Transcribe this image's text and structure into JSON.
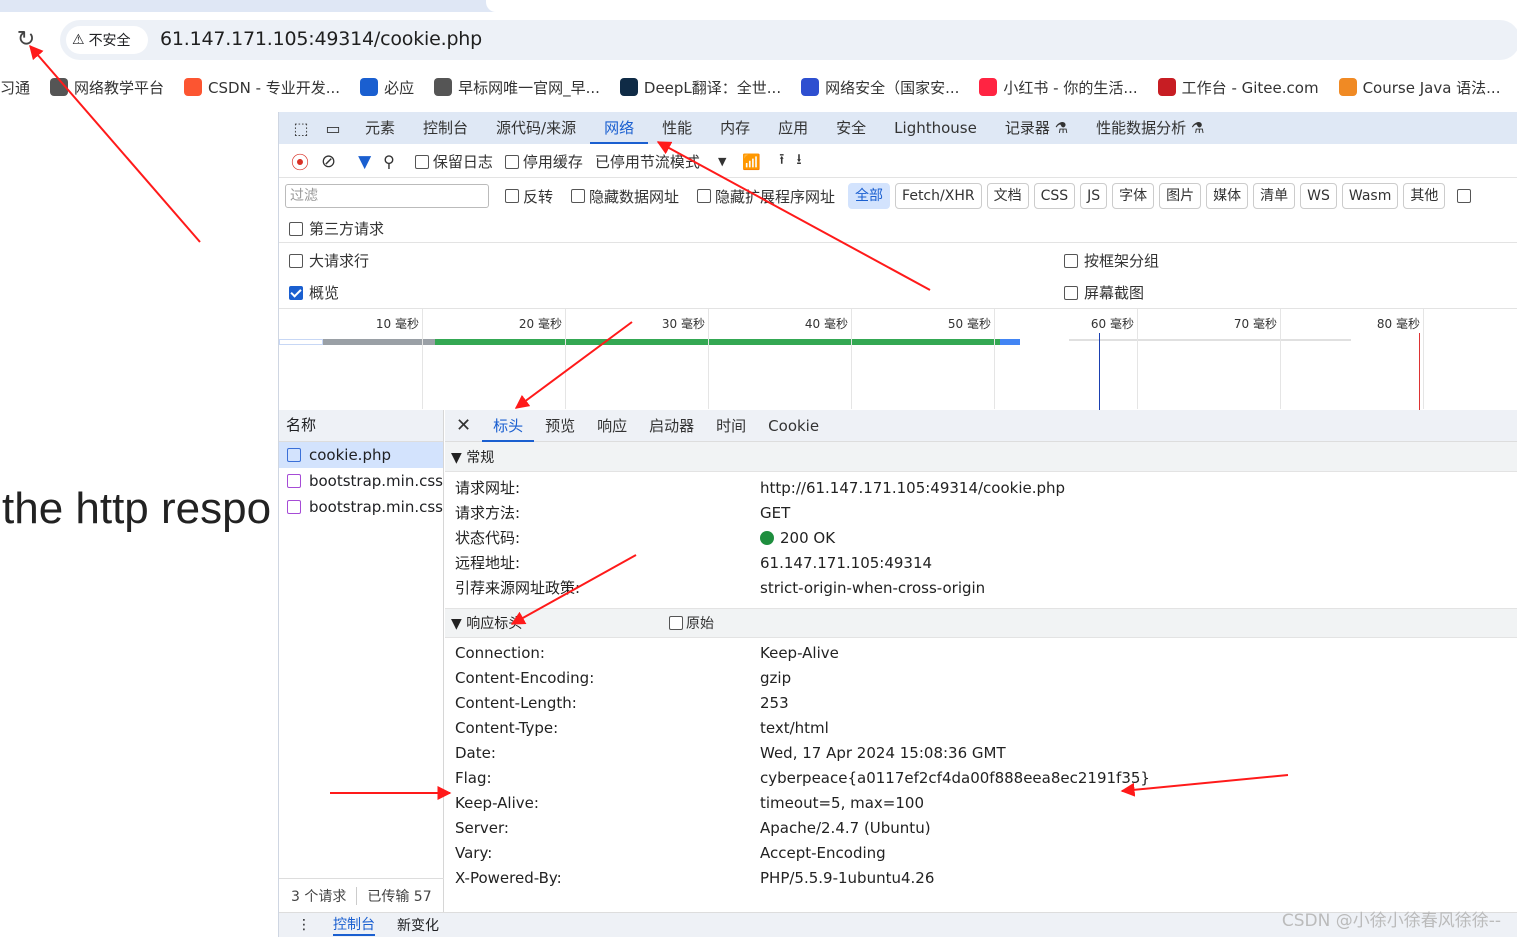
{
  "browser": {
    "security_label": "不安全",
    "url": "61.147.171.105:49314/cookie.php",
    "bookmarks": [
      {
        "label": "习通",
        "icon": "none",
        "color": "#ffffff"
      },
      {
        "label": "网络教学平台",
        "icon": "globe-icon",
        "color": "#555555"
      },
      {
        "label": "CSDN - 专业开发...",
        "icon": "csdn-icon",
        "color": "#fc5531"
      },
      {
        "label": "必应",
        "icon": "search-icon",
        "color": "#1a5fd0"
      },
      {
        "label": "早标网唯一官网_早...",
        "icon": "globe-icon",
        "color": "#555555"
      },
      {
        "label": "DeepL翻译：全世...",
        "icon": "deepl-icon",
        "color": "#0f2b46"
      },
      {
        "label": "网络安全（国家安...",
        "icon": "paw-icon",
        "color": "#2e4fd0"
      },
      {
        "label": "小红书 - 你的生活...",
        "icon": "xiaohongshu-icon",
        "color": "#ff2442"
      },
      {
        "label": "工作台 - Gitee.com",
        "icon": "gitee-icon",
        "color": "#c71d23"
      },
      {
        "label": "Course Java 语法...",
        "icon": "course-icon",
        "color": "#f08a24"
      }
    ]
  },
  "page": {
    "visible_text": "the http respo"
  },
  "devtools": {
    "tabs": [
      "元素",
      "控制台",
      "源代码/来源",
      "网络",
      "性能",
      "内存",
      "应用",
      "安全",
      "Lighthouse",
      "记录器 ⚗",
      "性能数据分析 ⚗"
    ],
    "active_tab": "网络",
    "toolbar": {
      "preserve_log": "保留日志",
      "disable_cache": "停用缓存",
      "throttle": "已停用节流模式"
    },
    "filter": {
      "placeholder": "过滤",
      "invert": "反转",
      "hide_data_urls": "隐藏数据网址",
      "hide_ext_urls": "隐藏扩展程序网址",
      "types": [
        "全部",
        "Fetch/XHR",
        "文档",
        "CSS",
        "JS",
        "字体",
        "图片",
        "媒体",
        "清单",
        "WS",
        "Wasm",
        "其他"
      ],
      "active_type": "全部"
    },
    "options": {
      "third_party": "第三方请求",
      "big_rows": "大请求行",
      "overview": "概览",
      "group_by_frame": "按框架分组",
      "screenshots": "屏幕截图"
    },
    "timeline_ticks": [
      "10 毫秒",
      "20 毫秒",
      "30 毫秒",
      "40 毫秒",
      "50 毫秒",
      "60 毫秒",
      "70 毫秒",
      "80 毫秒"
    ],
    "name_header": "名称",
    "requests": [
      {
        "name": "cookie.php",
        "type": "doc"
      },
      {
        "name": "bootstrap.min.css",
        "type": "css"
      },
      {
        "name": "bootstrap.min.css",
        "type": "css"
      }
    ],
    "status": {
      "count": "3 个请求",
      "transferred": "已传输 57"
    },
    "detail_tabs": [
      "标头",
      "预览",
      "响应",
      "启动器",
      "时间",
      "Cookie"
    ],
    "active_detail_tab": "标头",
    "general": {
      "title": "▼ 常规",
      "rows": [
        {
          "k": "请求网址:",
          "v": "http://61.147.171.105:49314/cookie.php"
        },
        {
          "k": "请求方法:",
          "v": "GET"
        },
        {
          "k": "状态代码:",
          "v": "200 OK"
        },
        {
          "k": "远程地址:",
          "v": "61.147.171.105:49314"
        },
        {
          "k": "引荐来源网址政策:",
          "v": "strict-origin-when-cross-origin"
        }
      ]
    },
    "response_headers": {
      "title": "▼ 响应标头",
      "raw_label": "原始",
      "rows": [
        {
          "k": "Connection:",
          "v": "Keep-Alive"
        },
        {
          "k": "Content-Encoding:",
          "v": "gzip"
        },
        {
          "k": "Content-Length:",
          "v": "253"
        },
        {
          "k": "Content-Type:",
          "v": "text/html"
        },
        {
          "k": "Date:",
          "v": "Wed, 17 Apr 2024 15:08:36 GMT"
        },
        {
          "k": "Flag:",
          "v": "cyberpeace{a0117ef2cf4da00f888eea8ec2191f35}"
        },
        {
          "k": "Keep-Alive:",
          "v": "timeout=5, max=100"
        },
        {
          "k": "Server:",
          "v": "Apache/2.4.7 (Ubuntu)"
        },
        {
          "k": "Vary:",
          "v": "Accept-Encoding"
        },
        {
          "k": "X-Powered-By:",
          "v": "PHP/5.5.9-1ubuntu4.26"
        }
      ]
    },
    "drawer": {
      "console": "控制台",
      "whats_new": "新变化"
    }
  },
  "watermark": "CSDN @小徐小徐春风徐徐--",
  "colors": {
    "accent": "#1a5fd0",
    "arrow": "#ff1a1a",
    "status_ok": "#1e8e3e"
  }
}
